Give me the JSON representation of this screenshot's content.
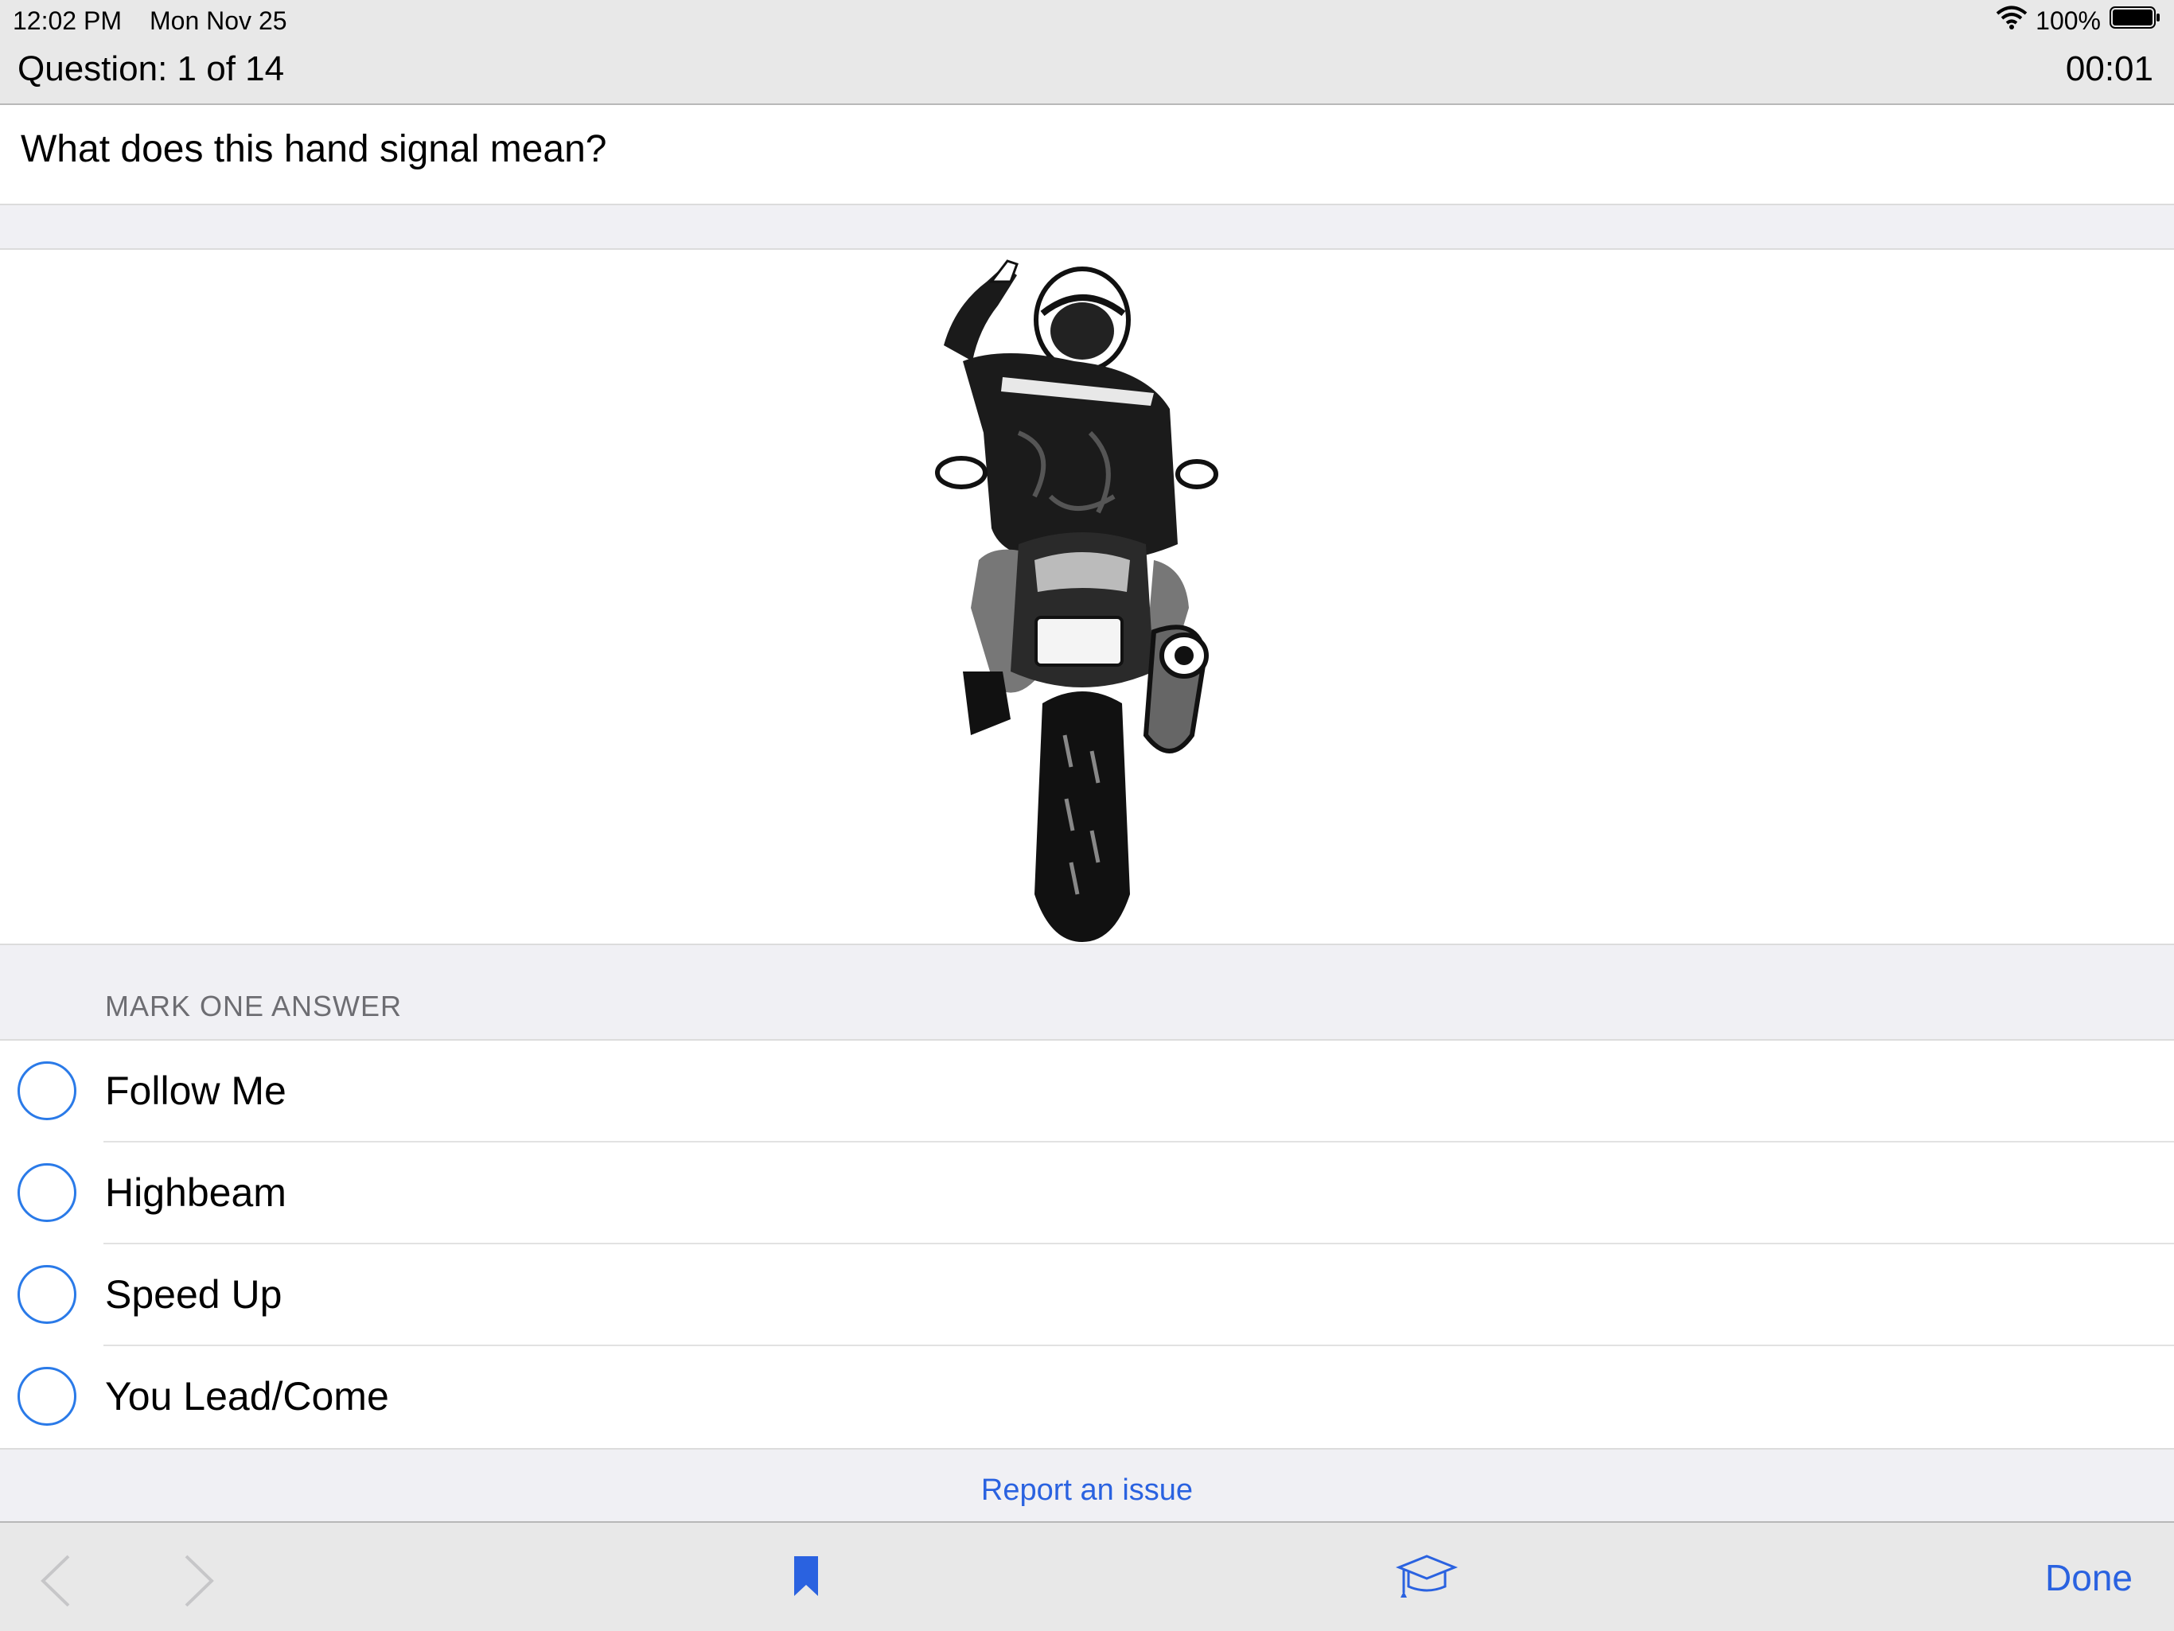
{
  "status_bar": {
    "time": "12:02 PM",
    "date": "Mon Nov 25",
    "battery": "100%",
    "icons": [
      "wifi-icon",
      "battery-icon"
    ]
  },
  "header": {
    "question_counter": "Question: 1 of 14",
    "timer": "00:01"
  },
  "question": {
    "text": "What does this hand signal mean?"
  },
  "section_header": "MARK ONE ANSWER",
  "answers": [
    {
      "label": "Follow Me"
    },
    {
      "label": "Highbeam"
    },
    {
      "label": "Speed Up"
    },
    {
      "label": "You Lead/Come"
    }
  ],
  "report_link": "Report an issue",
  "toolbar": {
    "done_label": "Done",
    "icons": [
      "chevron-left-icon",
      "chevron-right-icon",
      "bookmark-icon",
      "graduation-cap-icon"
    ]
  },
  "colors": {
    "accent": "#2a62e0",
    "radio": "#2a7ae8",
    "bar_bg": "#e8e8e8",
    "page_bg": "#f0f0f4"
  }
}
